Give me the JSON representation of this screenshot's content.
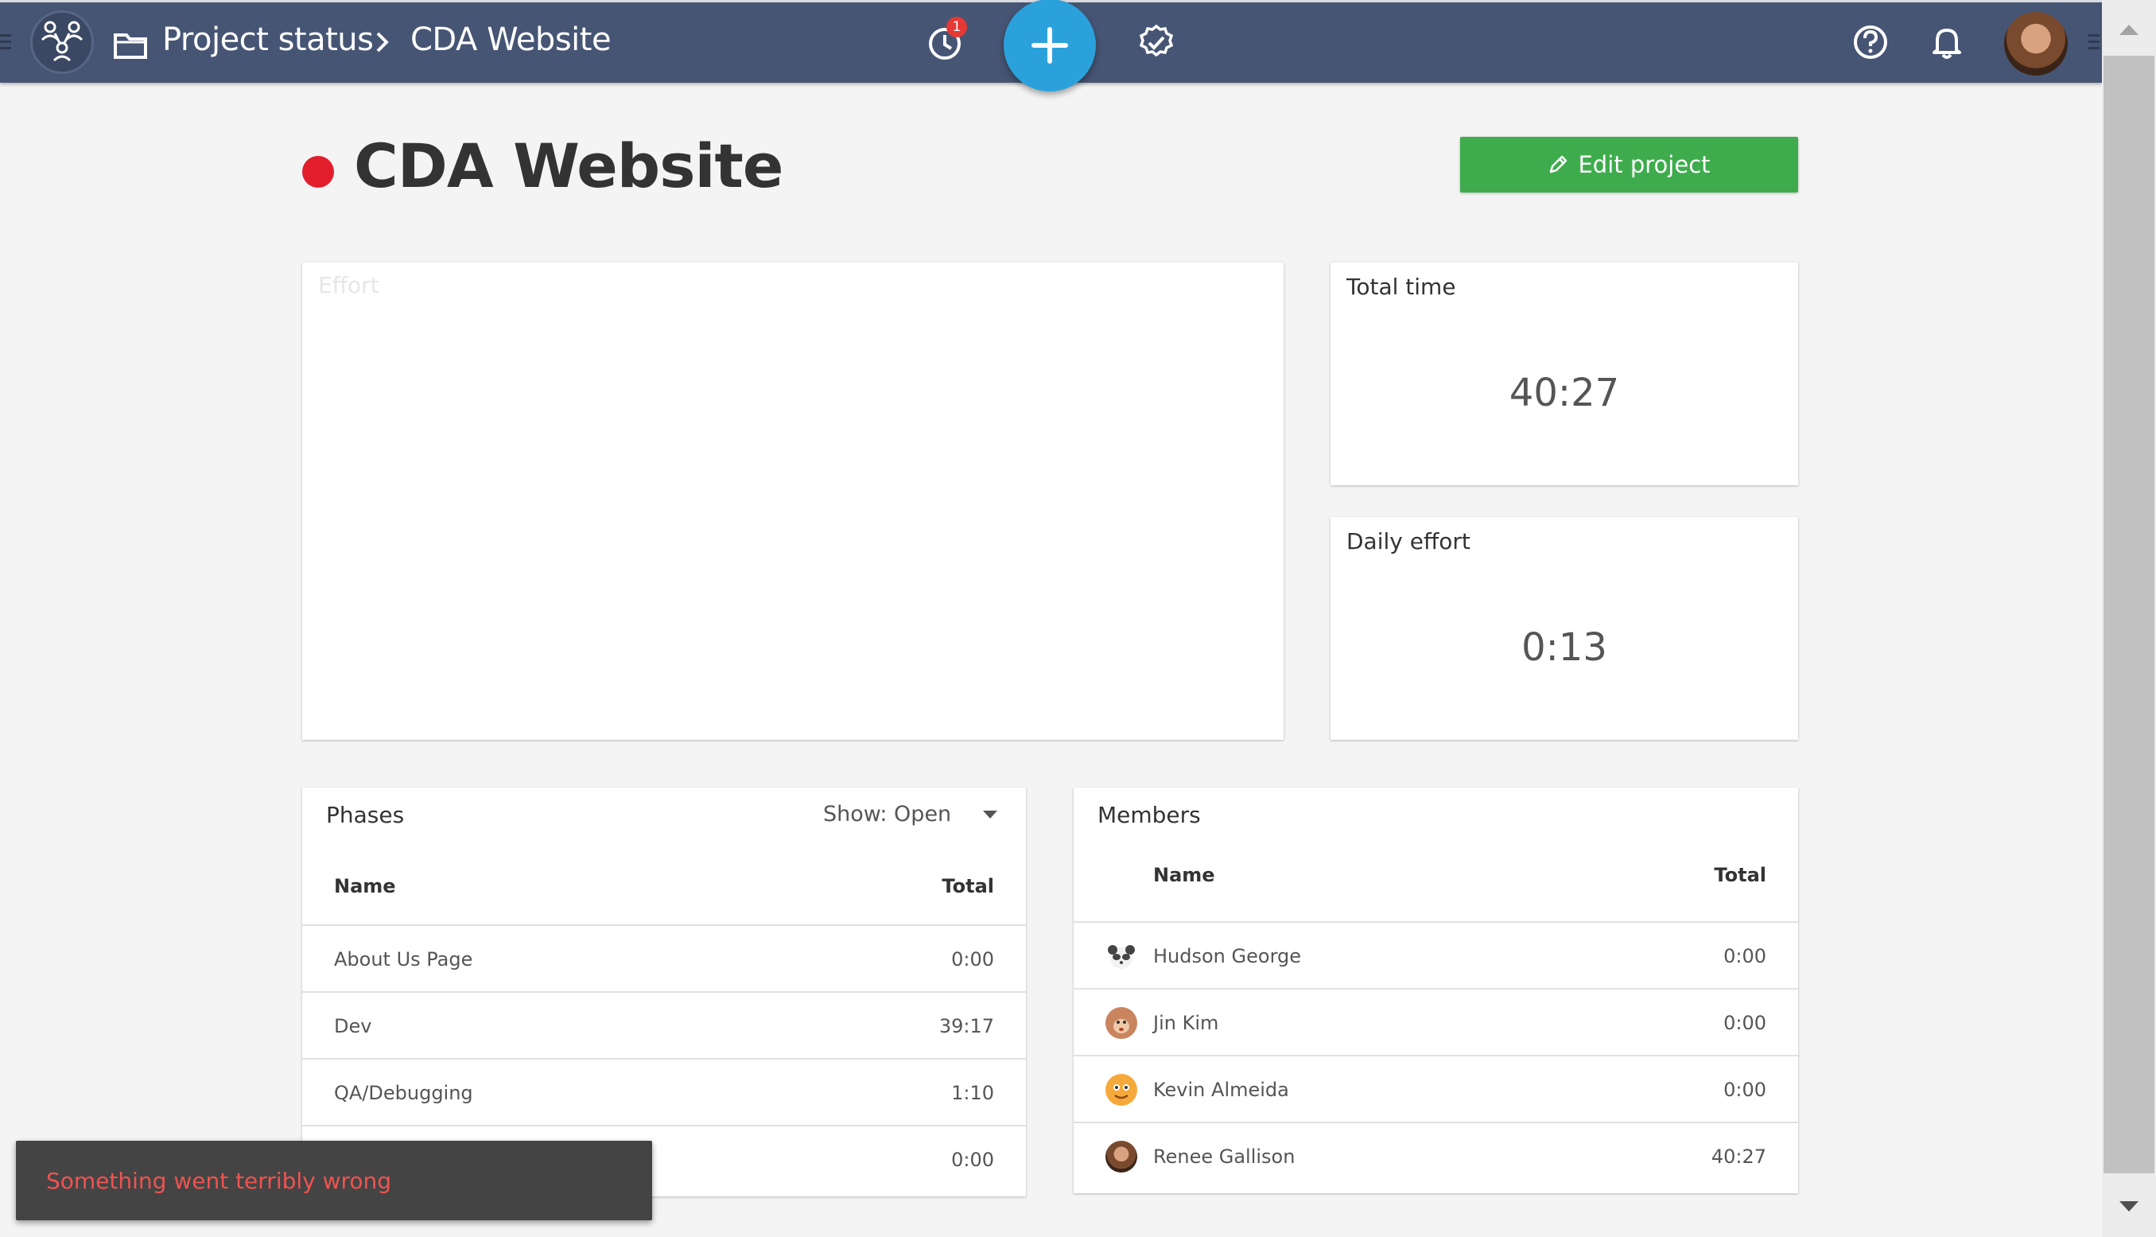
{
  "header": {
    "breadcrumb_root": "Project status",
    "breadcrumb_current": "CDA Website",
    "timer_badge": "1",
    "icons": [
      "menu-icon",
      "app-logo-icon",
      "folder-icon",
      "chevron-right-icon",
      "clock-icon",
      "plus-icon",
      "check-circle-icon",
      "help-icon",
      "bell-icon"
    ]
  },
  "project": {
    "title": "CDA Website",
    "status_color": "#e21e2c",
    "edit_label": "Edit project"
  },
  "effort": {
    "title": "Effort"
  },
  "total_time": {
    "title": "Total time",
    "value": "40:27"
  },
  "daily_effort": {
    "title": "Daily effort",
    "value": "0:13"
  },
  "phases": {
    "title": "Phases",
    "filter_label": "Show: Open",
    "col_name": "Name",
    "col_total": "Total",
    "rows": [
      {
        "name": "About Us Page",
        "total": "0:00"
      },
      {
        "name": "Dev",
        "total": "39:17"
      },
      {
        "name": "QA/Debugging",
        "total": "1:10"
      },
      {
        "name": "",
        "total": "0:00"
      }
    ]
  },
  "members": {
    "title": "Members",
    "col_name": "Name",
    "col_total": "Total",
    "rows": [
      {
        "name": "Hudson George",
        "total": "0:00"
      },
      {
        "name": "Jin Kim",
        "total": "0:00"
      },
      {
        "name": "Kevin Almeida",
        "total": "0:00"
      },
      {
        "name": "Renee Gallison",
        "total": "40:27"
      }
    ]
  },
  "toast": {
    "message": "Something went terribly wrong"
  },
  "colors": {
    "header": "#465574",
    "accent": "#2ba1dc",
    "success": "#3eac4d",
    "danger": "#e21e2c"
  }
}
